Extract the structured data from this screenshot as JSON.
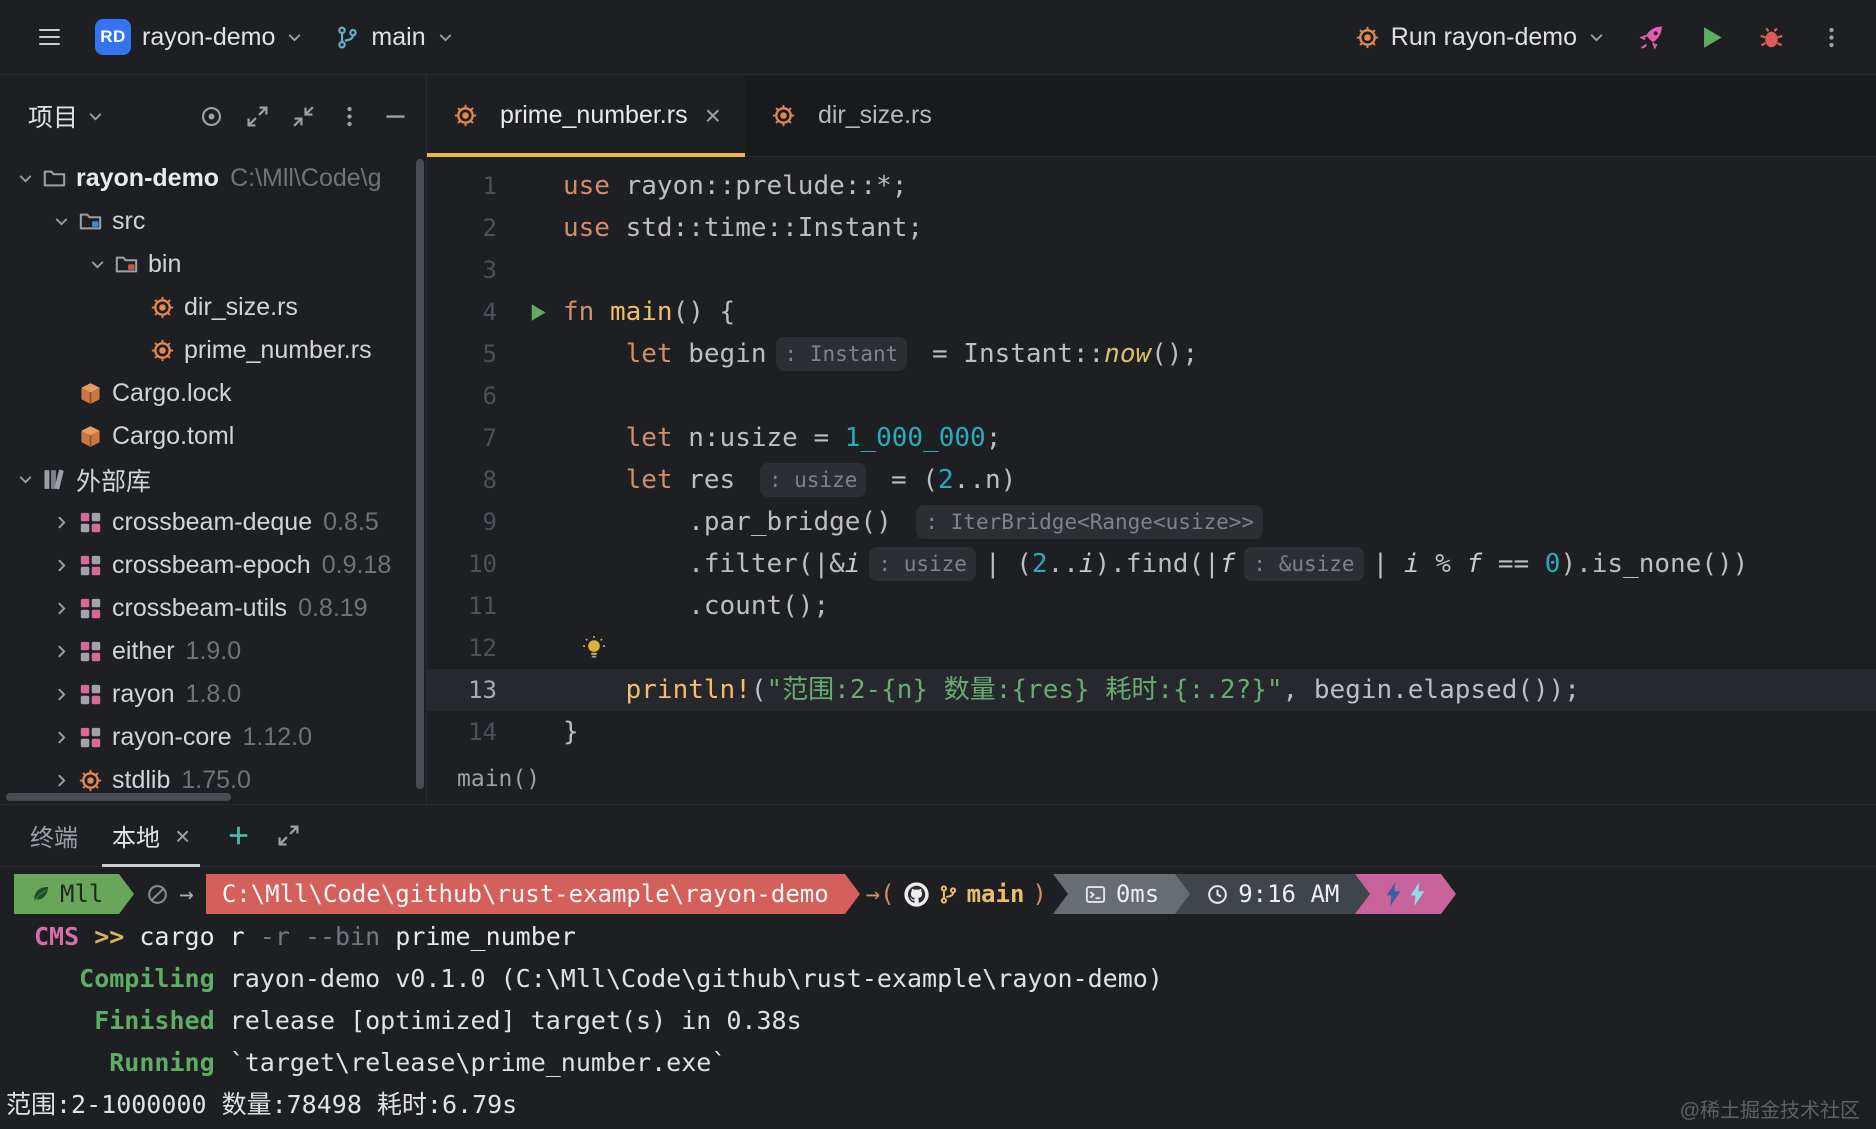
{
  "colors": {
    "accent_blue": "#3574f0",
    "tab_underline": "#e9b64c",
    "seg_user_bg": "#69a65c",
    "seg_path_bg": "#d4605c",
    "seg_duration_bg": "#686c73",
    "seg_time_bg": "#40444b",
    "seg_bolt_bg": "#c9639c"
  },
  "toolbar": {
    "project_badge": "RD",
    "project_name": "rayon-demo",
    "branch_name": "main",
    "run_config_label": "Run rayon-demo"
  },
  "project_panel": {
    "title": "项目",
    "tree": [
      {
        "level": 0,
        "chevron": "down",
        "icon": "folder",
        "label": "rayon-demo",
        "bold": true,
        "suffix": "C:\\Mll\\Code\\g"
      },
      {
        "level": 1,
        "chevron": "down",
        "icon": "folder-src",
        "label": "src"
      },
      {
        "level": 2,
        "chevron": "down",
        "icon": "folder-bin",
        "label": "bin"
      },
      {
        "level": 3,
        "chevron": "none",
        "icon": "rust-file",
        "label": "dir_size.rs"
      },
      {
        "level": 3,
        "chevron": "none",
        "icon": "rust-file",
        "label": "prime_number.rs"
      },
      {
        "level": 1,
        "chevron": "none",
        "icon": "cargo",
        "label": "Cargo.lock"
      },
      {
        "level": 1,
        "chevron": "none",
        "icon": "cargo",
        "label": "Cargo.toml"
      },
      {
        "level": 0,
        "chevron": "down",
        "icon": "library",
        "label": "外部库"
      },
      {
        "level": 1,
        "chevron": "right",
        "icon": "package",
        "label": "crossbeam-deque",
        "suffix": "0.8.5"
      },
      {
        "level": 1,
        "chevron": "right",
        "icon": "package",
        "label": "crossbeam-epoch",
        "suffix": "0.9.18"
      },
      {
        "level": 1,
        "chevron": "right",
        "icon": "package",
        "label": "crossbeam-utils",
        "suffix": "0.8.19"
      },
      {
        "level": 1,
        "chevron": "right",
        "icon": "package",
        "label": "either",
        "suffix": "1.9.0"
      },
      {
        "level": 1,
        "chevron": "right",
        "icon": "package",
        "label": "rayon",
        "suffix": "1.8.0"
      },
      {
        "level": 1,
        "chevron": "right",
        "icon": "package",
        "label": "rayon-core",
        "suffix": "1.12.0"
      },
      {
        "level": 1,
        "chevron": "right",
        "icon": "rust-file",
        "label": "stdlib",
        "suffix": "1.75.0"
      }
    ]
  },
  "editor": {
    "tabs": [
      {
        "label": "prime_number.rs",
        "active": true,
        "closable": true
      },
      {
        "label": "dir_size.rs",
        "active": false,
        "closable": false
      }
    ],
    "breadcrumb": "main()",
    "code_lines": [
      {
        "num": 1,
        "tokens": [
          [
            "kw",
            "use "
          ],
          [
            "pl",
            "rayon::prelude::*;"
          ]
        ]
      },
      {
        "num": 2,
        "tokens": [
          [
            "kw",
            "use "
          ],
          [
            "pl",
            "std::time::Instant;"
          ]
        ]
      },
      {
        "num": 3,
        "tokens": []
      },
      {
        "num": 4,
        "gutter": "run",
        "tokens": [
          [
            "kw",
            "fn "
          ],
          [
            "fn",
            "main"
          ],
          [
            "pl",
            "() {"
          ]
        ]
      },
      {
        "num": 5,
        "tokens": [
          [
            "pl",
            "    "
          ],
          [
            "kw",
            "let "
          ],
          [
            "pl",
            "begin"
          ],
          [
            "hint",
            ": Instant"
          ],
          [
            "pl",
            " = Instant::"
          ],
          [
            "fnit",
            "now"
          ],
          [
            "pl",
            "();"
          ]
        ]
      },
      {
        "num": 6,
        "tokens": []
      },
      {
        "num": 7,
        "tokens": [
          [
            "pl",
            "    "
          ],
          [
            "kw",
            "let "
          ],
          [
            "pl",
            "n:usize = "
          ],
          [
            "num",
            "1_000_000"
          ],
          [
            "pl",
            ";"
          ]
        ]
      },
      {
        "num": 8,
        "tokens": [
          [
            "pl",
            "    "
          ],
          [
            "kw",
            "let "
          ],
          [
            "pl",
            "res "
          ],
          [
            "hint",
            ": usize"
          ],
          [
            "pl",
            " = ("
          ],
          [
            "num",
            "2"
          ],
          [
            "pl",
            "..n)"
          ]
        ]
      },
      {
        "num": 9,
        "tokens": [
          [
            "pl",
            "        .par_bridge() "
          ],
          [
            "hint",
            ": IterBridge<Range<usize>>"
          ]
        ]
      },
      {
        "num": 10,
        "tokens": [
          [
            "pl",
            "        .filter(|&"
          ],
          [
            "param",
            "i"
          ],
          [
            "hint",
            ": usize"
          ],
          [
            "pl",
            "| ("
          ],
          [
            "num",
            "2"
          ],
          [
            "pl",
            ".."
          ],
          [
            "param",
            "i"
          ],
          [
            "pl",
            ").find(|"
          ],
          [
            "param",
            "f"
          ],
          [
            "hint",
            ": &usize"
          ],
          [
            "pl",
            "| "
          ],
          [
            "param",
            "i"
          ],
          [
            "pl",
            " % "
          ],
          [
            "param",
            "f"
          ],
          [
            "pl",
            " == "
          ],
          [
            "num",
            "0"
          ],
          [
            "pl",
            ").is_none())"
          ]
        ]
      },
      {
        "num": 11,
        "tokens": [
          [
            "pl",
            "        .count();"
          ]
        ]
      },
      {
        "num": 12,
        "bulb": true,
        "tokens": []
      },
      {
        "num": 13,
        "highlight": true,
        "tokens": [
          [
            "pl",
            "    "
          ],
          [
            "macro",
            "println!"
          ],
          [
            "pl",
            "("
          ],
          [
            "str",
            "\"范围:2-{n} 数量:{res} 耗时:{:.2?}\""
          ],
          [
            "pl",
            ", begin.elapsed());"
          ]
        ]
      },
      {
        "num": 14,
        "tokens": [
          [
            "pl",
            "}"
          ]
        ]
      }
    ]
  },
  "terminal": {
    "panel_title": "终端",
    "tab_label": "本地",
    "prompt": {
      "user": "Mll",
      "arrow": "→",
      "path": "C:\\Mll\\Code\\github\\rust-example\\rayon-demo",
      "git_open": "→(",
      "git_branch": "main",
      "git_close": ")",
      "duration": "0ms",
      "time": "9:16 AM"
    },
    "lines": [
      {
        "tokens": [
          [
            "shell",
            "CMS"
          ],
          [
            "chev",
            " >> "
          ],
          [
            "cmd",
            "cargo r "
          ],
          [
            "flag",
            "-r --bin "
          ],
          [
            "cmd",
            "prime_number"
          ]
        ]
      },
      {
        "tokens": [
          [
            "green",
            "   Compiling "
          ],
          [
            "out",
            "rayon-demo v0.1.0 (C:\\Mll\\Code\\github\\rust-example\\rayon-demo)"
          ]
        ]
      },
      {
        "tokens": [
          [
            "green",
            "    Finished "
          ],
          [
            "out",
            "release [optimized] target(s) in 0.38s"
          ]
        ]
      },
      {
        "tokens": [
          [
            "green",
            "     Running "
          ],
          [
            "out",
            "`target\\release\\prime_number.exe`"
          ]
        ]
      },
      {
        "pad": 6,
        "tokens": [
          [
            "out",
            "范围:2-1000000 数量:78498 耗时:6.79s"
          ]
        ]
      }
    ]
  },
  "watermark": "@稀土掘金技术社区"
}
